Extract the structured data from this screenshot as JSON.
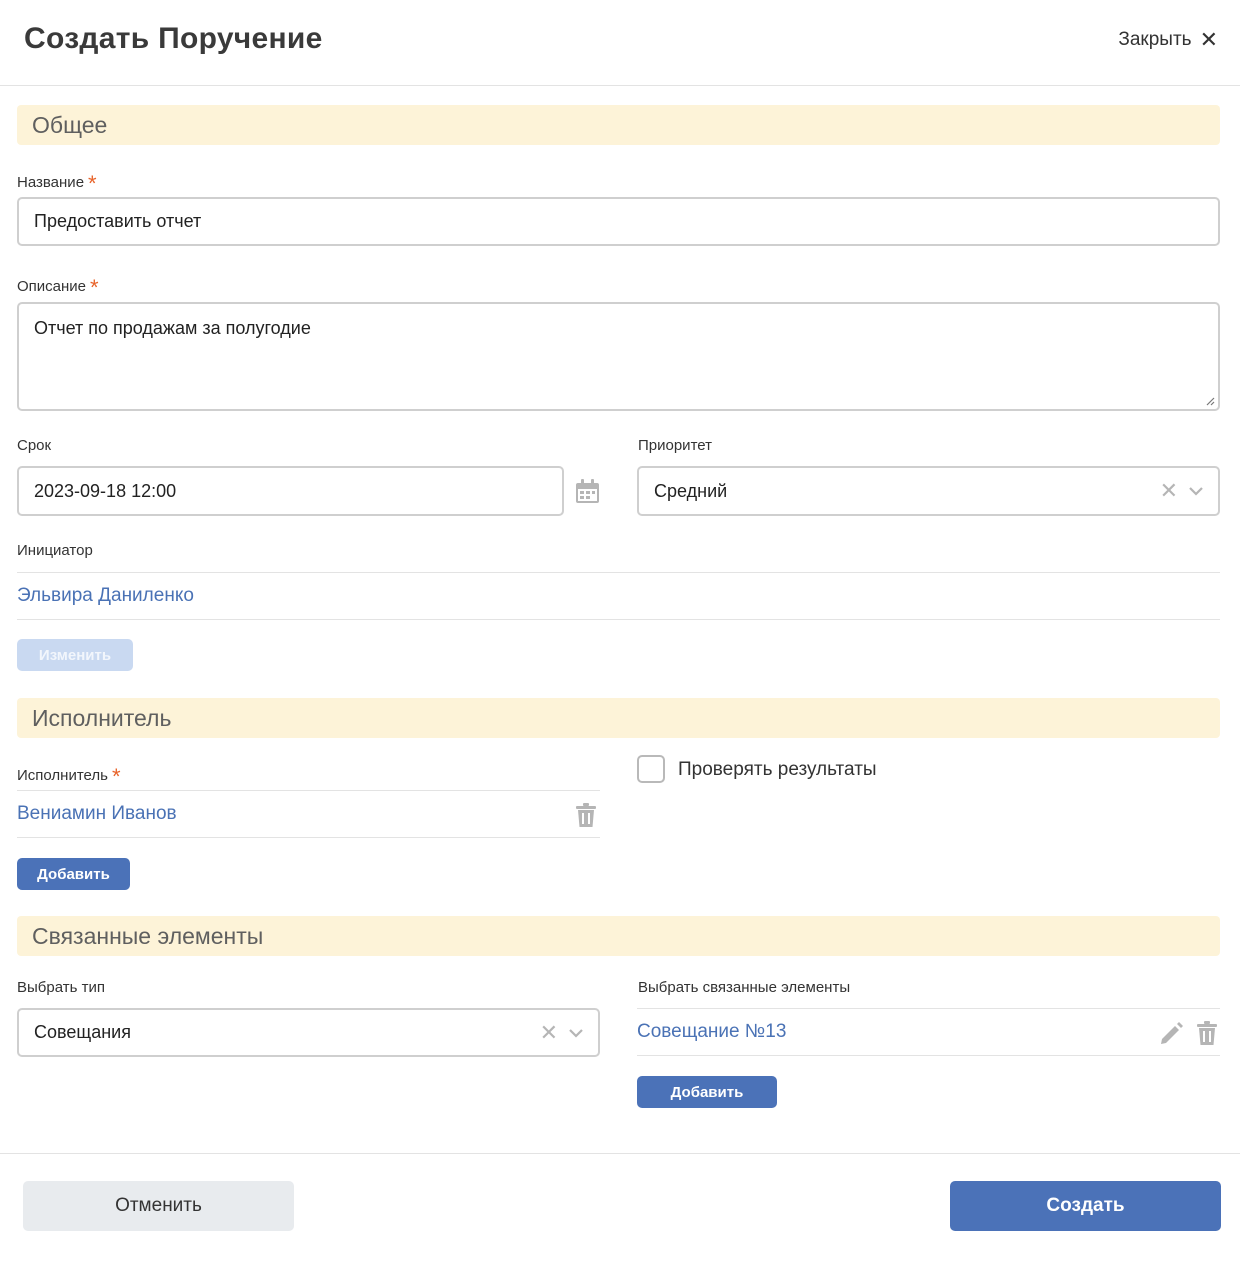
{
  "header": {
    "title": "Создать Поручение",
    "close_label": "Закрыть"
  },
  "sections": {
    "general": "Общее",
    "executor": "Исполнитель",
    "related": "Связанные элементы"
  },
  "form": {
    "name_label": "Название",
    "name_value": "Предоставить отчет",
    "description_label": "Описание",
    "description_value": "Отчет по продажам за полугодие",
    "deadline_label": "Срок",
    "deadline_value": "2023-09-18 12:00",
    "priority_label": "Приоритет",
    "priority_value": "Средний",
    "initiator_label": "Инициатор",
    "initiator_value": "Эльвира Даниленко",
    "change_label": "Изменить"
  },
  "executor": {
    "label": "Исполнитель",
    "value": "Вениамин Иванов",
    "add_label": "Добавить",
    "check_results_label": "Проверять результаты"
  },
  "related": {
    "type_label": "Выбрать тип",
    "type_value": "Совещания",
    "elements_label": "Выбрать связанные элементы",
    "element_value": "Совещание №13",
    "add_label": "Добавить"
  },
  "footer": {
    "cancel_label": "Отменить",
    "create_label": "Создать"
  },
  "icons": {
    "close": "close-icon",
    "calendar": "calendar-icon",
    "clear": "clear-icon",
    "chevron": "chevron-down-icon",
    "trash": "trash-icon",
    "edit": "pencil-icon"
  },
  "colors": {
    "accent": "#4b72b8",
    "section_bg": "#fdf3d8",
    "required": "#e8632a",
    "link": "#4a72b5"
  }
}
